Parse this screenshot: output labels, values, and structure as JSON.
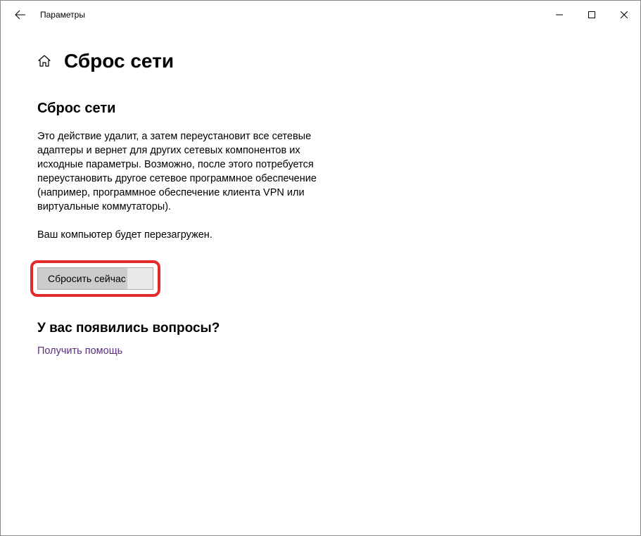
{
  "titlebar": {
    "title": "Параметры"
  },
  "page": {
    "title": "Сброс сети",
    "section_heading": "Сброс сети",
    "description": "Это действие удалит, а затем переустановит все сетевые адаптеры и вернет для других сетевых компонентов их исходные параметры. Возможно, после этого потребуется переустановить другое сетевое программное обеспечение (например, программное обеспечение клиента VPN или виртуальные коммутаторы).",
    "reboot_notice": "Ваш компьютер будет перезагружен.",
    "reset_button": "Сбросить сейчас",
    "questions_heading": "У вас появились вопросы?",
    "help_link": "Получить помощь"
  }
}
